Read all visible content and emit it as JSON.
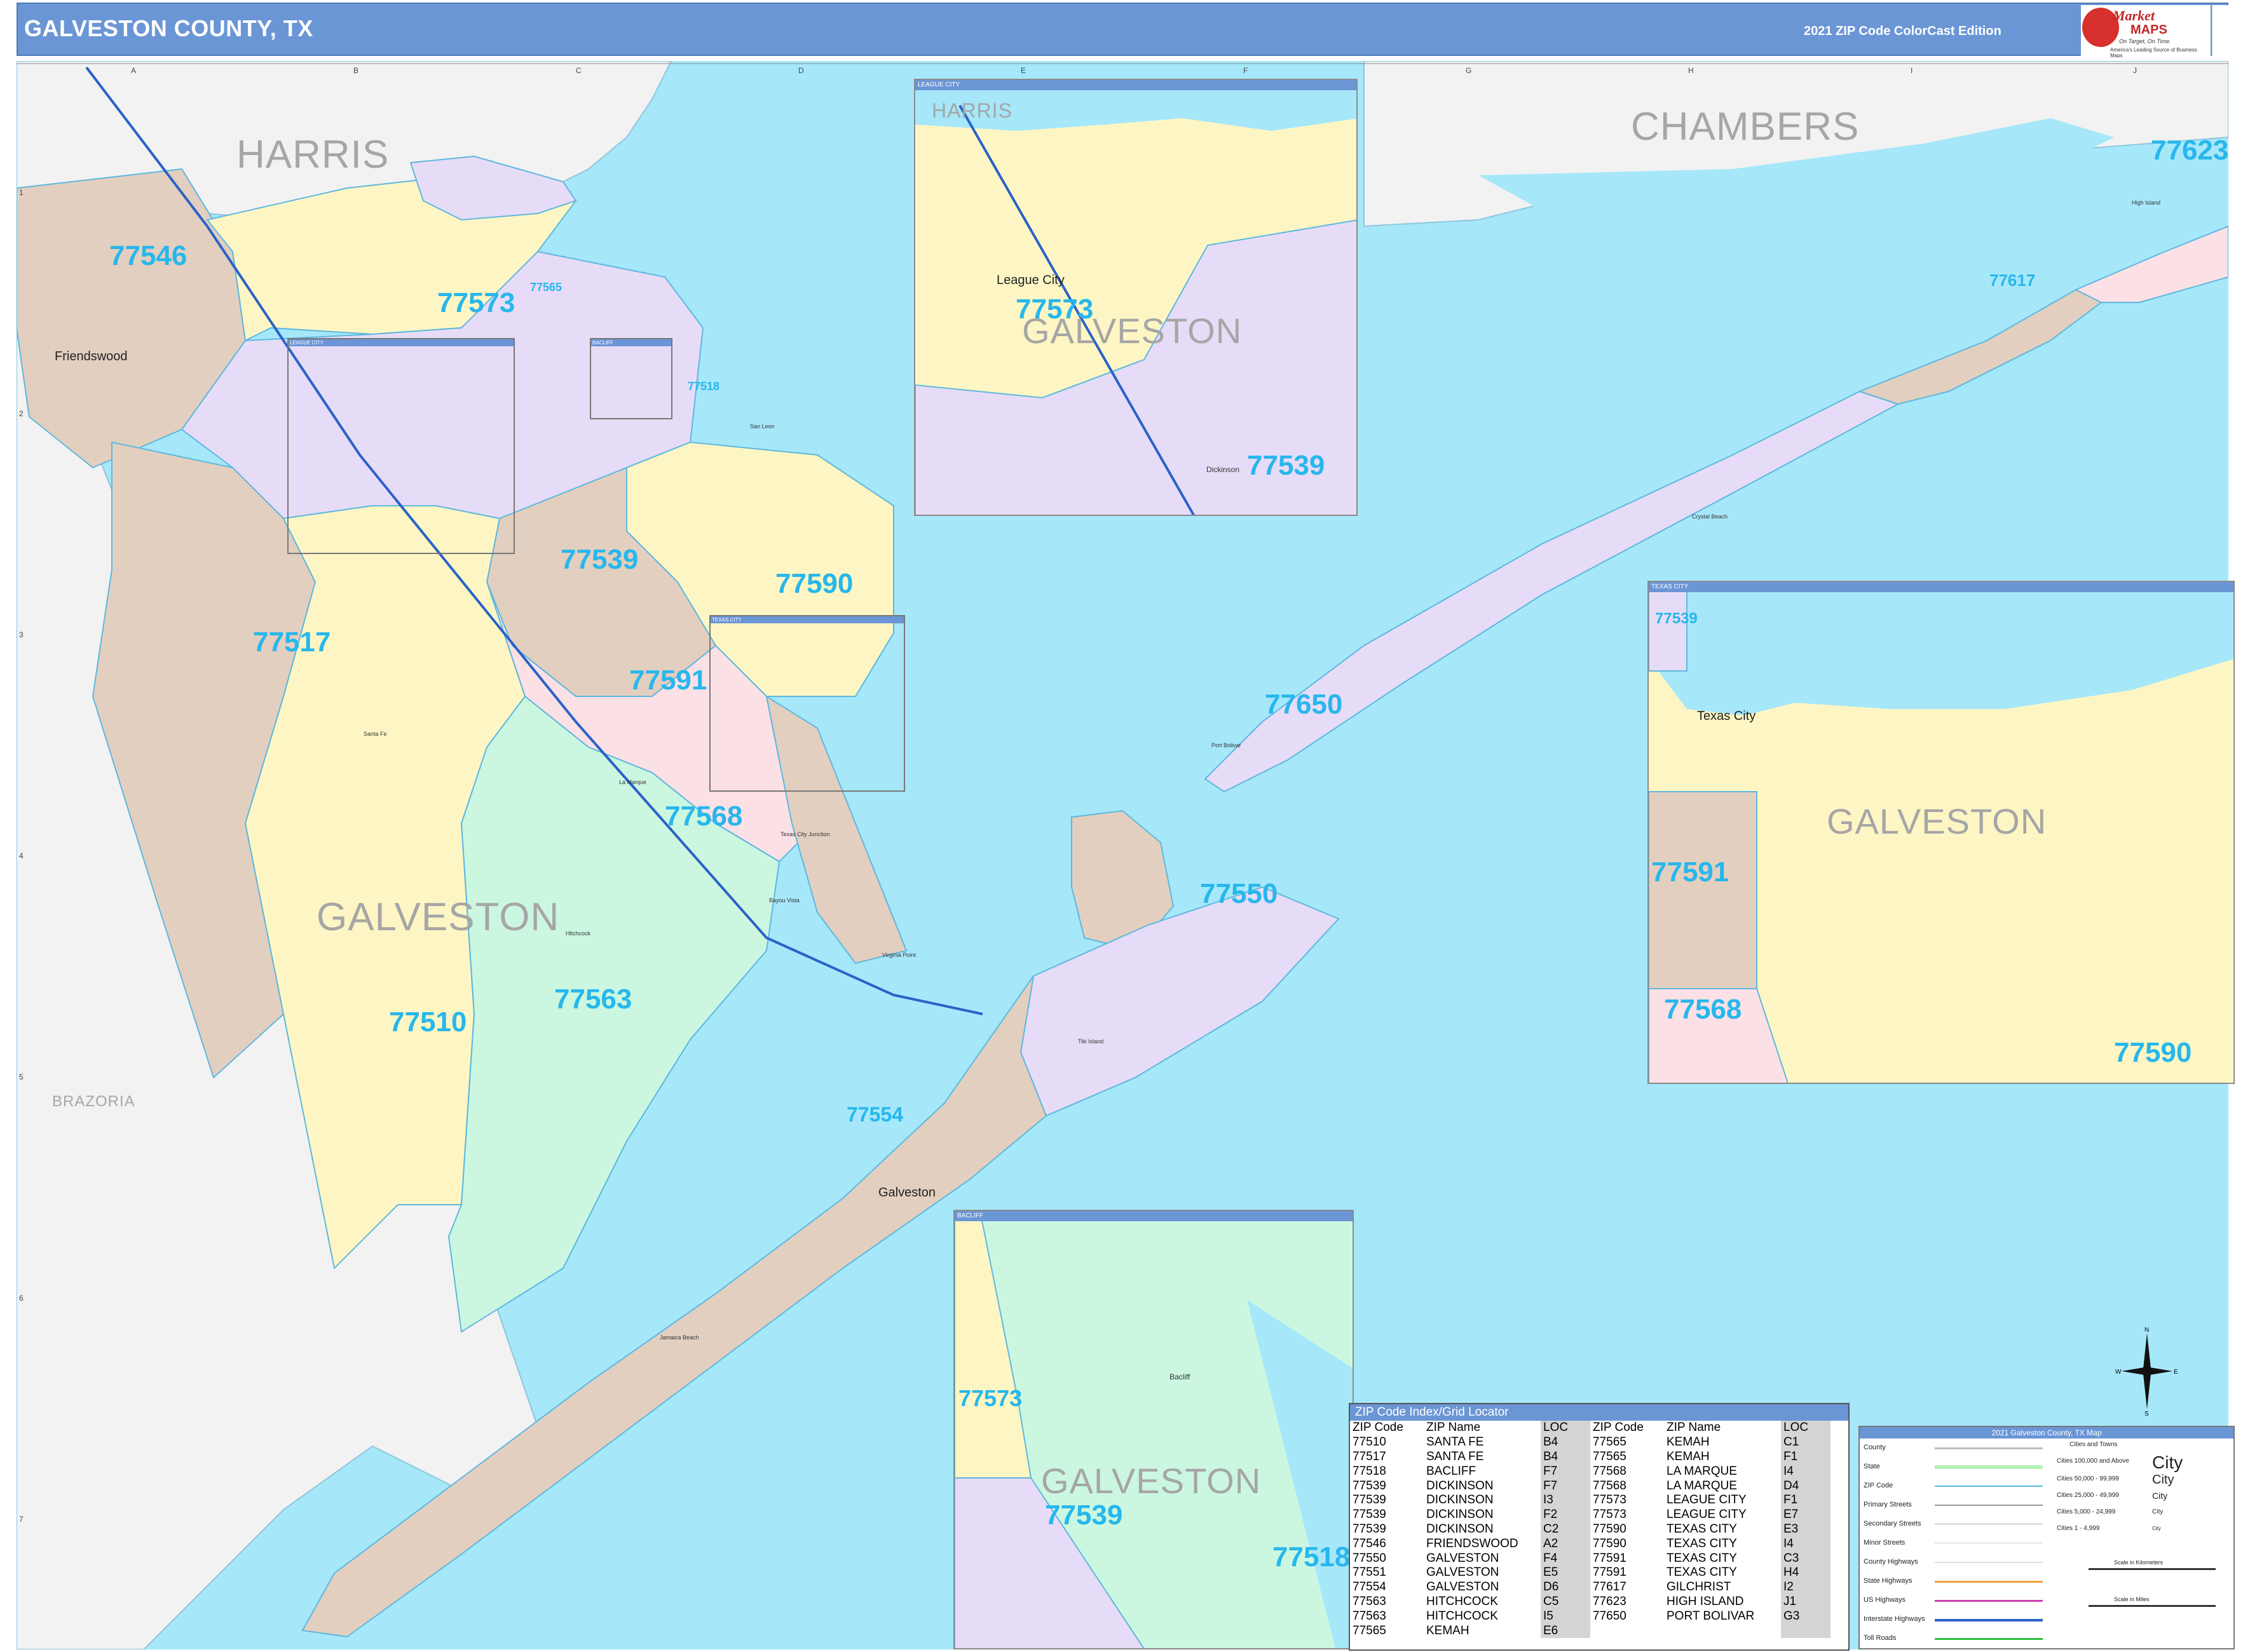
{
  "header": {
    "title": "GALVESTON COUNTY, TX",
    "edition": "2021 ZIP Code ColorCast Edition"
  },
  "logo": {
    "name_top": "Market",
    "name_bottom": "MAPS",
    "tagline": "On Target, On Time.",
    "tagline2": "America's Leading Source of Business Maps"
  },
  "grid": {
    "columns": [
      "A",
      "B",
      "C",
      "D",
      "E",
      "F",
      "G",
      "H",
      "I",
      "J"
    ],
    "rows": [
      "1",
      "2",
      "3",
      "4",
      "5",
      "6",
      "7"
    ]
  },
  "counties": {
    "harris": "HARRIS",
    "chambers": "CHAMBERS",
    "galveston": "GALVESTON",
    "brazoria": "BRAZORIA"
  },
  "zips": {
    "z77546": "77546",
    "z77573": "77573",
    "z77565": "77565",
    "z77518": "77518",
    "z77539": "77539",
    "z77590": "77590",
    "z77517": "77517",
    "z77591": "77591",
    "z77568": "77568",
    "z77563": "77563",
    "z77510": "77510",
    "z77550": "77550",
    "z77554": "77554",
    "z77650": "77650",
    "z77617": "77617",
    "z77623": "77623"
  },
  "cities": {
    "friendswood": "Friendswood",
    "galveston": "Galveston",
    "league_city": "League City",
    "texas_city": "Texas City",
    "la_marque": "La Marque",
    "santa_fe": "Santa Fe",
    "hitchcock": "Hitchcock",
    "kemah": "Kemah",
    "bacliff": "Bacliff",
    "dickinson": "Dickinson",
    "port_bolivar": "Port Bolivar",
    "high_island": "High Island",
    "crystal_beach": "Crystal Beach",
    "tiki_island": "Tiki Island",
    "jamaica_beach": "Jamaica Beach",
    "san_leon": "San Leon",
    "texas_city_junction": "Texas City Junction",
    "bayou_vista": "Bayou Vista",
    "virginia_point": "Virginia Point",
    "hill_town": "Hitchcock"
  },
  "insets": {
    "league_city": {
      "bar": "LEAGUE CITY",
      "county_top": "HARRIS",
      "county": "GALVESTON",
      "city": "League City",
      "city2": "Dickinson",
      "zip_a": "77573",
      "zip_b": "77539"
    },
    "texas_city": {
      "bar": "TEXAS CITY",
      "county": "GALVESTON",
      "city": "Texas City",
      "zip_a": "77539",
      "zip_b": "77591",
      "zip_c": "77568",
      "zip_d": "77590"
    },
    "bacliff": {
      "bar": "BACLIFF",
      "county": "GALVESTON",
      "city": "Bacliff",
      "zip_a": "77573",
      "zip_b": "77539",
      "zip_c": "77518"
    },
    "small_league": "LEAGUE CITY",
    "small_bacliff": "BACLIFF",
    "small_texas": "TEXAS CITY"
  },
  "index": {
    "title": "ZIP Code Index/Grid Locator",
    "headers": [
      "ZIP Code",
      "ZIP Name",
      "LOC",
      "ZIP Code",
      "ZIP Name",
      "LOC"
    ],
    "rows": [
      [
        "77510",
        "SANTA FE",
        "B4",
        "77565",
        "KEMAH",
        "C1"
      ],
      [
        "77517",
        "SANTA FE",
        "B4",
        "77565",
        "KEMAH",
        "F1"
      ],
      [
        "77518",
        "BACLIFF",
        "F7",
        "77568",
        "LA MARQUE",
        "I4"
      ],
      [
        "77539",
        "DICKINSON",
        "F7",
        "77568",
        "LA MARQUE",
        "D4"
      ],
      [
        "77539",
        "DICKINSON",
        "I3",
        "77573",
        "LEAGUE CITY",
        "F1"
      ],
      [
        "77539",
        "DICKINSON",
        "F2",
        "77573",
        "LEAGUE CITY",
        "E7"
      ],
      [
        "77539",
        "DICKINSON",
        "C2",
        "77590",
        "TEXAS CITY",
        "E3"
      ],
      [
        "77546",
        "FRIENDSWOOD",
        "A2",
        "77590",
        "TEXAS CITY",
        "I4"
      ],
      [
        "77550",
        "GALVESTON",
        "F4",
        "77591",
        "TEXAS CITY",
        "C3"
      ],
      [
        "77551",
        "GALVESTON",
        "E5",
        "77591",
        "TEXAS CITY",
        "H4"
      ],
      [
        "77554",
        "GALVESTON",
        "D6",
        "77617",
        "GILCHRIST",
        "I2"
      ],
      [
        "77563",
        "HITCHCOCK",
        "C5",
        "77623",
        "HIGH ISLAND",
        "J1"
      ],
      [
        "77563",
        "HITCHCOCK",
        "I5",
        "77650",
        "PORT BOLIVAR",
        "G3"
      ],
      [
        "77565",
        "KEMAH",
        "E6",
        "",
        "",
        ""
      ]
    ]
  },
  "legend": {
    "title": "2021 Galveston County, TX Map",
    "rows": [
      "County",
      "State",
      "ZIP Code",
      "Primary Streets",
      "Secondary Streets",
      "Minor Streets",
      "County Highways",
      "State Highways",
      "US Highways",
      "Interstate Highways",
      "Toll Roads"
    ],
    "cities_header": "Cities and Towns",
    "city_tiers": [
      "Cities 100,000 and Above",
      "Cities 50,000 - 99,999",
      "Cities 25,000 - 49,999",
      "Cities 5,000 - 24,999",
      "Cities 1 - 4,999"
    ],
    "city_samples": [
      "City",
      "City",
      "City",
      "City",
      "City"
    ],
    "scale_km": "Scale in Kilometers",
    "scale_mi": "Scale in Miles"
  },
  "compass": {
    "n": "N",
    "s": "S",
    "e": "E",
    "w": "W"
  },
  "colors": {
    "water": "#a6e7fa",
    "land": "#f2f2f2",
    "zip_yellow": "#fdf6c4",
    "zip_purple": "#e7dcf7",
    "zip_tan": "#e3cfbf",
    "zip_pink": "#fbe0e6",
    "zip_green": "#cbf7e1",
    "header": "#6b96d6",
    "zip_label": "#27b7ec"
  }
}
